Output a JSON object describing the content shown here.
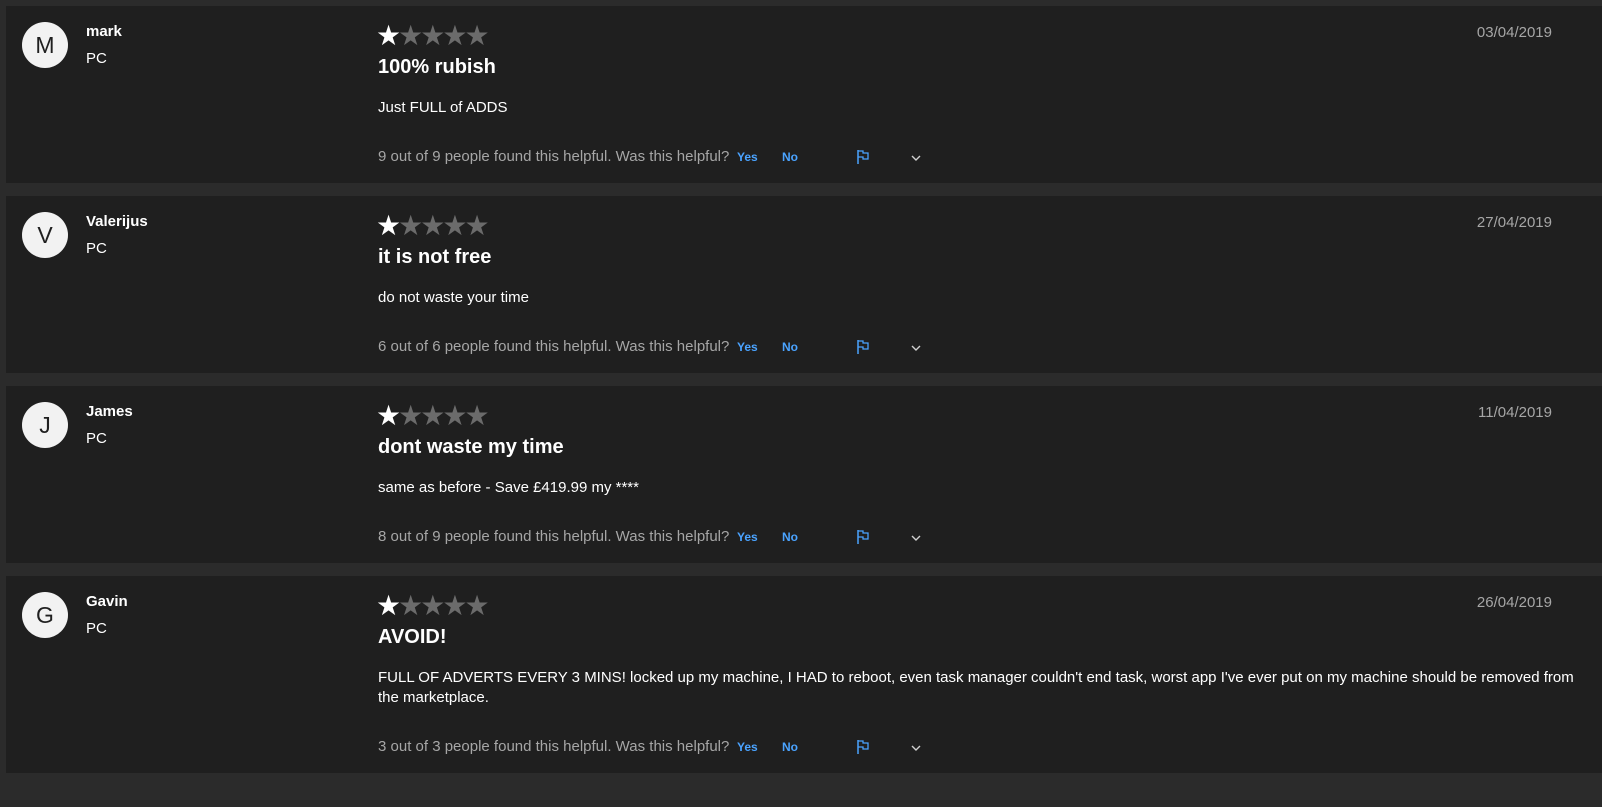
{
  "reviews": [
    {
      "initial": "M",
      "author": "mark",
      "platform": "PC",
      "rating": 1,
      "rating_max": 5,
      "title": "100% rubish",
      "body": "Just FULL of ADDS",
      "date": "03/04/2019",
      "helpful_text": "9 out of 9 people found this helpful. Was this helpful?",
      "yes_label": "Yes",
      "no_label": "No"
    },
    {
      "initial": "V",
      "author": "Valerijus",
      "platform": "PC",
      "rating": 1,
      "rating_max": 5,
      "title": "it is not free",
      "body": "do not waste your time",
      "date": "27/04/2019",
      "helpful_text": "6 out of 6 people found this helpful. Was this helpful?",
      "yes_label": "Yes",
      "no_label": "No"
    },
    {
      "initial": "J",
      "author": "James",
      "platform": "PC",
      "rating": 1,
      "rating_max": 5,
      "title": "dont waste my time",
      "body": "same as before - Save £419.99 my ****",
      "date": "11/04/2019",
      "helpful_text": "8 out of 9 people found this helpful. Was this helpful?",
      "yes_label": "Yes",
      "no_label": "No"
    },
    {
      "initial": "G",
      "author": "Gavin",
      "platform": "PC",
      "rating": 1,
      "rating_max": 5,
      "title": "AVOID!",
      "body": "FULL OF ADVERTS EVERY 3 MINS! locked up my machine, I HAD to reboot, even task manager couldn't end task, worst app I've ever put on my machine should be removed from the marketplace.",
      "date": "26/04/2019",
      "helpful_text": "3 out of 3 people found this helpful. Was this helpful?",
      "yes_label": "Yes",
      "no_label": "No"
    }
  ],
  "icons": {
    "report": "flag-icon",
    "expand": "chevron-down-icon"
  },
  "colors": {
    "page_background": "#2b2b2b",
    "card_background": "#1f1f1f",
    "accent_link": "#4aa3ff",
    "star_filled": "#ffffff",
    "star_empty": "#6b6b6b",
    "secondary_text": "#a6a6a6"
  }
}
